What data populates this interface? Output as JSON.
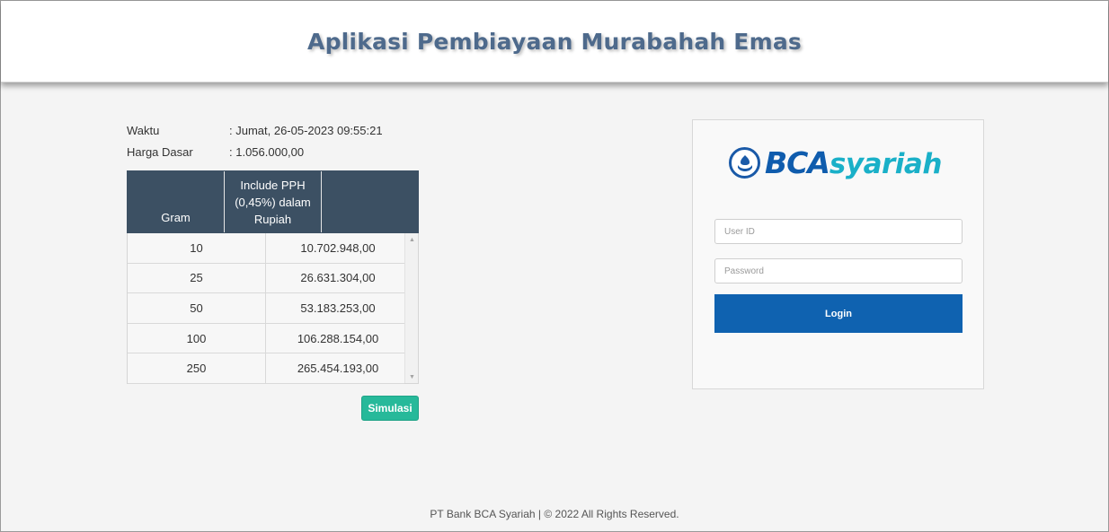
{
  "header": {
    "title": "Aplikasi Pembiayaan Murabahah Emas"
  },
  "info": {
    "waktu_label": "Waktu",
    "waktu_value": ": Jumat, 26-05-2023 09:55:21",
    "harga_label": "Harga Dasar",
    "harga_value": ": 1.056.000,00"
  },
  "table": {
    "col_gram": "Gram",
    "col_price": "Include PPH (0,45%) dalam Rupiah",
    "rows": [
      {
        "gram": "10",
        "price": "10.702.948,00"
      },
      {
        "gram": "25",
        "price": "26.631.304,00"
      },
      {
        "gram": "50",
        "price": "53.183.253,00"
      },
      {
        "gram": "100",
        "price": "106.288.154,00"
      },
      {
        "gram": "250",
        "price": "265.454.193,00"
      }
    ]
  },
  "simulasi_label": "Simulasi",
  "login": {
    "logo_bca": "BCA",
    "logo_syariah": "syariah",
    "user_placeholder": "User ID",
    "password_placeholder": "Password",
    "button_label": "Login"
  },
  "footer": {
    "text": "PT Bank BCA Syariah | © 2022 All Rights Reserved."
  },
  "colors": {
    "header_title": "#4e6a8c",
    "table_header_bg": "#3c5063",
    "simulasi_bg": "#27b99a",
    "login_bg": "#0f62b0",
    "logo_blue": "#0f5cad",
    "logo_cyan": "#1ab0c8"
  }
}
